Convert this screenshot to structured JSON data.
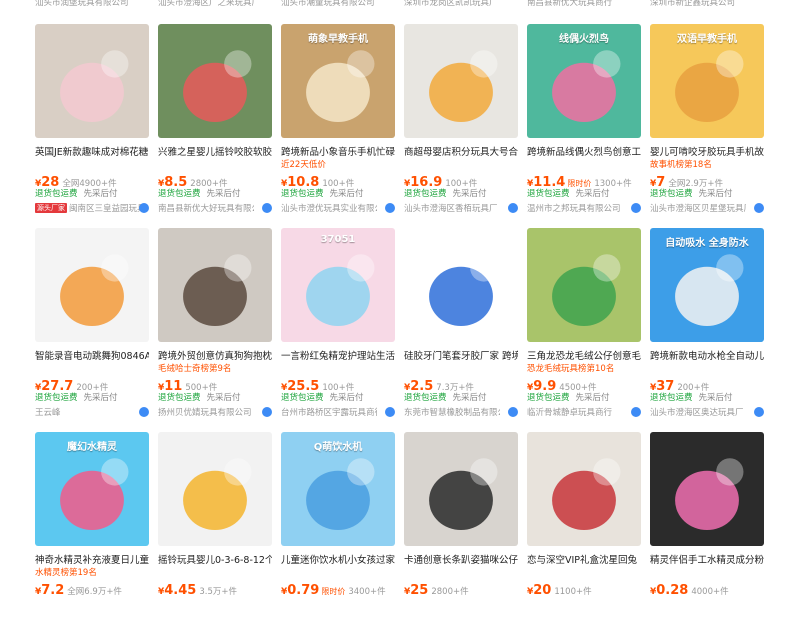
{
  "top_shops": [
    "汕头市润堡玩具有限公司",
    "汕头市澄海区广之来玩具厂",
    "汕头市潮童玩具有限公司",
    "深圳市龙岗区凯凯玩具厂",
    "南昌县新优大玩具商行",
    "深圳市新企鑫玩具公司"
  ],
  "products": [
    {
      "thumb_label": "",
      "title": "英国JE新款趣味成对棉花糖",
      "tag": "",
      "currency": "¥",
      "price": "28",
      "price_note": "",
      "sold": "全网4900+件",
      "service1": "退货包运费",
      "service2": "先采后付",
      "shop": "闽南区三皇益园玩具",
      "shop_badge": "源头厂家",
      "colors": [
        "#d9cfc5",
        "#f3c9d0"
      ]
    },
    {
      "thumb_label": "",
      "title": "兴雅之星婴儿摇铃咬胶软胶",
      "tag": "",
      "currency": "¥",
      "price": "8.5",
      "price_note": "",
      "sold": "2800+件",
      "service1": "退货包运费",
      "service2": "先采后付",
      "shop": "南昌县新优大好玩具有限公司",
      "shop_badge": "",
      "colors": [
        "#6f8f5e",
        "#e85a5a"
      ]
    },
    {
      "thumb_label": "萌象早教手机",
      "title": "跨境新品小象音乐手机忙碌",
      "tag": "近22天低价",
      "currency": "¥",
      "price": "10.8",
      "price_note": "",
      "sold": "100+件",
      "service1": "退货包运费",
      "service2": "先采后付",
      "shop": "汕头市澄优玩具实业有限公司",
      "shop_badge": "",
      "colors": [
        "#c9a36e",
        "#f5e6c8"
      ]
    },
    {
      "thumb_label": "",
      "title": "商超母婴店积分玩具大号合",
      "tag": "",
      "currency": "¥",
      "price": "16.9",
      "price_note": "",
      "sold": "100+件",
      "service1": "退货包运费",
      "service2": "先采后付",
      "shop": "汕头市澄海区香栢玩具厂",
      "shop_badge": "",
      "colors": [
        "#e8e6e1",
        "#f2a93b"
      ]
    },
    {
      "thumb_label": "线偶火烈鸟",
      "title": "跨境新品线偶火烈鸟创意工",
      "tag": "",
      "currency": "¥",
      "price": "11.4",
      "price_note": "限时价",
      "sold": "1300+件",
      "service1": "退货包运费",
      "service2": "先采后付",
      "shop": "温州市之邦玩具有限公司",
      "shop_badge": "",
      "colors": [
        "#4fb89d",
        "#f06fa2"
      ]
    },
    {
      "thumb_label": "双语早教手机",
      "title": "婴儿可啃咬牙胶玩具手机故",
      "tag": "故事机榜第18名",
      "currency": "¥",
      "price": "7",
      "price_note": "",
      "sold": "全网2.9万+件",
      "service1": "退货包运费",
      "service2": "先采后付",
      "shop": "汕头市澄海区贝星堡玩具厂",
      "shop_badge": "",
      "colors": [
        "#f6c85a",
        "#e8a040"
      ]
    },
    {
      "thumb_label": "",
      "title": "智能录音电动跳舞狗0846A",
      "tag": "",
      "currency": "¥",
      "price": "27.7",
      "price_note": "",
      "sold": "200+件",
      "service1": "退货包运费",
      "service2": "先采后付",
      "shop": "王云峰",
      "shop_badge": "",
      "colors": [
        "#f4f4f4",
        "#f29a3a"
      ]
    },
    {
      "thumb_label": "",
      "title": "跨境外贸创意仿真狗狗抱枕",
      "tag": "毛绒哈士奇榜第9名",
      "currency": "¥",
      "price": "11",
      "price_note": "",
      "sold": "500+件",
      "service1": "退货包运费",
      "service2": "先采后付",
      "shop": "扬州贝优婧玩具有限公司",
      "shop_badge": "",
      "colors": [
        "#cfc9c2",
        "#5a4a3e"
      ]
    },
    {
      "thumb_label": "37051",
      "title": "一言粉红兔精宠护理站生活",
      "tag": "",
      "currency": "¥",
      "price": "25.5",
      "price_note": "",
      "sold": "100+件",
      "service1": "退货包运费",
      "service2": "先采后付",
      "shop": "台州市路桥区宇露玩具商行",
      "shop_badge": "",
      "colors": [
        "#f7d9e6",
        "#8fd3f0"
      ]
    },
    {
      "thumb_label": "",
      "title": "硅胶牙门笔套牙胶厂家 跨境",
      "tag": "",
      "currency": "¥",
      "price": "2.5",
      "price_note": "",
      "sold": "7.3万+件",
      "service1": "退货包运费",
      "service2": "先采后付",
      "shop": "东莞市智慧橡胶制品有限公司",
      "shop_badge": "",
      "colors": [
        "#ffffff",
        "#2e6fd9"
      ]
    },
    {
      "thumb_label": "",
      "title": "三角龙恐龙毛绒公仔创意毛",
      "tag": "恐龙毛绒玩具榜第10名",
      "currency": "¥",
      "price": "9.9",
      "price_note": "",
      "sold": "4500+件",
      "service1": "退货包运费",
      "service2": "先采后付",
      "shop": "临沂骨城静卓玩具商行",
      "shop_badge": "",
      "colors": [
        "#a9c46a",
        "#3fa34d"
      ]
    },
    {
      "thumb_label": "自动吸水 全身防水",
      "title": "跨境新款电动水枪全自动儿",
      "tag": "",
      "currency": "¥",
      "price": "37",
      "price_note": "",
      "sold": "200+件",
      "service1": "退货包运费",
      "service2": "先采后付",
      "shop": "汕头市澄海区奥达玩具厂",
      "shop_badge": "",
      "colors": [
        "#3d9ee8",
        "#f2f2f2"
      ]
    },
    {
      "thumb_label": "魔幻水精灵",
      "title": "神奇水精灵补充液夏日儿童",
      "tag": "水精灵榜第19名",
      "currency": "¥",
      "price": "7.2",
      "price_note": "",
      "sold": "全网6.9万+件",
      "service1": "",
      "service2": "",
      "shop": "",
      "shop_badge": "",
      "colors": [
        "#5cc8f0",
        "#f25a8a"
      ]
    },
    {
      "thumb_label": "",
      "title": "摇铃玩具婴儿0-3-6-8-12个",
      "tag": "",
      "currency": "¥",
      "price": "4.45",
      "price_note": "",
      "sold": "3.5万+件",
      "service1": "",
      "service2": "",
      "shop": "",
      "shop_badge": "",
      "colors": [
        "#f2f2f2",
        "#f5b52e"
      ]
    },
    {
      "thumb_label": "Q萌饮水机",
      "title": "儿童迷你饮水机小女孩过家",
      "tag": "",
      "currency": "¥",
      "price": "0.79",
      "price_note": "限时价",
      "sold": "3400+件",
      "service1": "",
      "service2": "",
      "shop": "",
      "shop_badge": "",
      "colors": [
        "#8fd0f2",
        "#4a9fe0"
      ]
    },
    {
      "thumb_label": "",
      "title": "卡通创意长条趴姿猫咪公仔",
      "tag": "",
      "currency": "¥",
      "price": "25",
      "price_note": "",
      "sold": "2800+件",
      "service1": "",
      "service2": "",
      "shop": "",
      "shop_badge": "",
      "colors": [
        "#d8d4cf",
        "#2a2a2a"
      ]
    },
    {
      "thumb_label": "",
      "title": "恋与深空VIP礼盒沈星回兔",
      "tag": "",
      "currency": "¥",
      "price": "20",
      "price_note": "",
      "sold": "1100+件",
      "service1": "",
      "service2": "",
      "shop": "",
      "shop_badge": "",
      "colors": [
        "#e8e3dc",
        "#c7353a"
      ]
    },
    {
      "thumb_label": "",
      "title": "精灵伴侣手工水精灵成分粉",
      "tag": "",
      "currency": "¥",
      "price": "0.28",
      "price_note": "",
      "sold": "4000+件",
      "service1": "",
      "service2": "",
      "shop": "",
      "shop_badge": "",
      "colors": [
        "#2b2b2b",
        "#f06fb0"
      ]
    }
  ]
}
